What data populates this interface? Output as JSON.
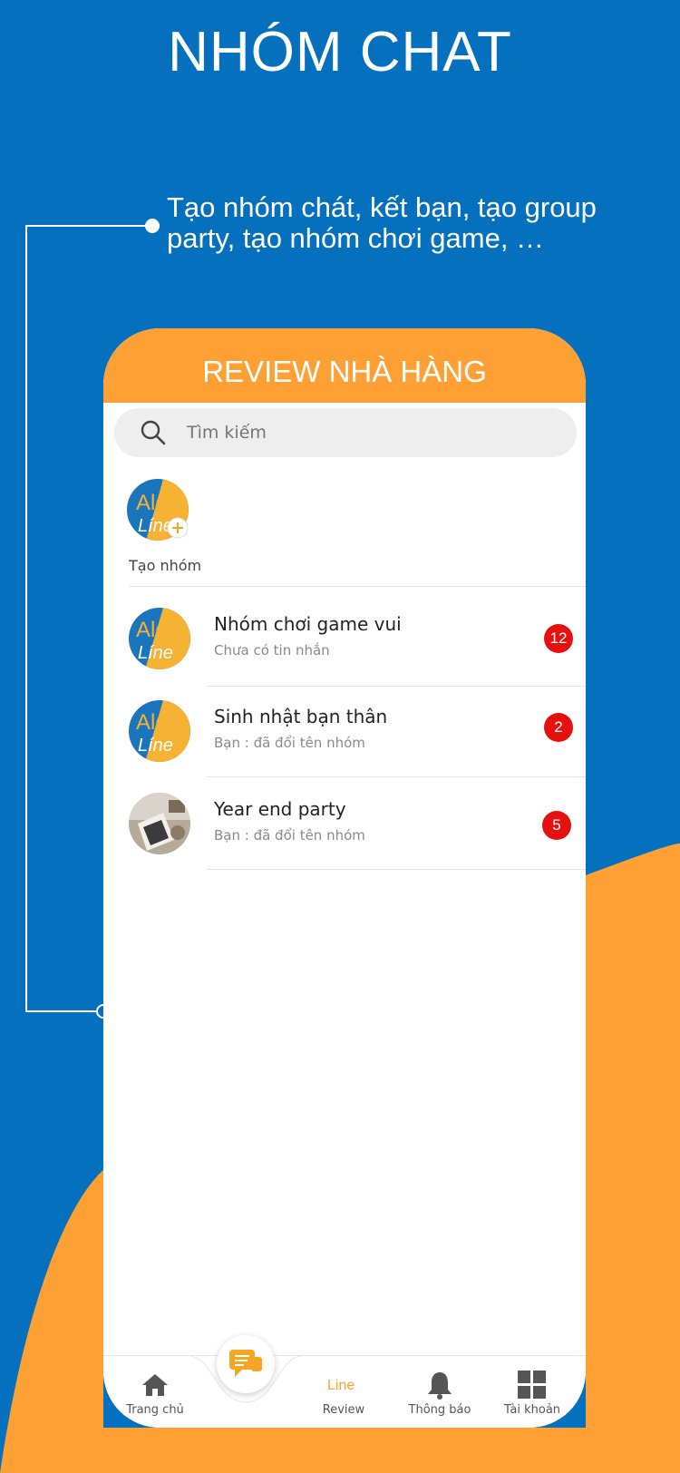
{
  "headline": "NHÓM CHAT",
  "caption": "Tạo nhóm chát, kết bạn, tạo group party, tạo nhóm chơi game, …",
  "colors": {
    "blue": "#0570bd",
    "orange": "#fea033",
    "badge": "#e51010"
  },
  "app": {
    "title": "REVIEW NHÀ HÀNG",
    "search": {
      "placeholder": "Tìm kiếm",
      "icon": "search-icon"
    },
    "create_group": {
      "label": "Tạo nhóm",
      "logo_text_1": "Alo",
      "logo_text_2": "Líne",
      "icon": "plus-icon"
    },
    "chats": [
      {
        "name": "Nhóm chơi game vui",
        "preview": "Chưa có tin nhắn",
        "unread": "12",
        "avatar": "alo-line-logo",
        "logo_text_1": "Alo",
        "logo_text_2": "Líne"
      },
      {
        "name": "Sinh nhật bạn thân",
        "preview": "Bạn : đã đổi tên nhóm",
        "unread": "2",
        "avatar": "alo-line-logo",
        "logo_text_1": "Alo",
        "logo_text_2": "Líne"
      },
      {
        "name": "Year end party",
        "preview": "Bạn : đã đổi tên nhóm",
        "unread": "5",
        "avatar": "party-photo"
      }
    ],
    "tabs": [
      {
        "label": "Trang chủ",
        "icon": "home-icon"
      },
      {
        "label": "",
        "icon": "chat-bubble-icon"
      },
      {
        "label": "Review",
        "icon": "line-logo-icon",
        "logo_text": "Line"
      },
      {
        "label": "Thông báo",
        "icon": "bell-icon"
      },
      {
        "label": "Tài khoản",
        "icon": "grid-icon"
      }
    ]
  }
}
